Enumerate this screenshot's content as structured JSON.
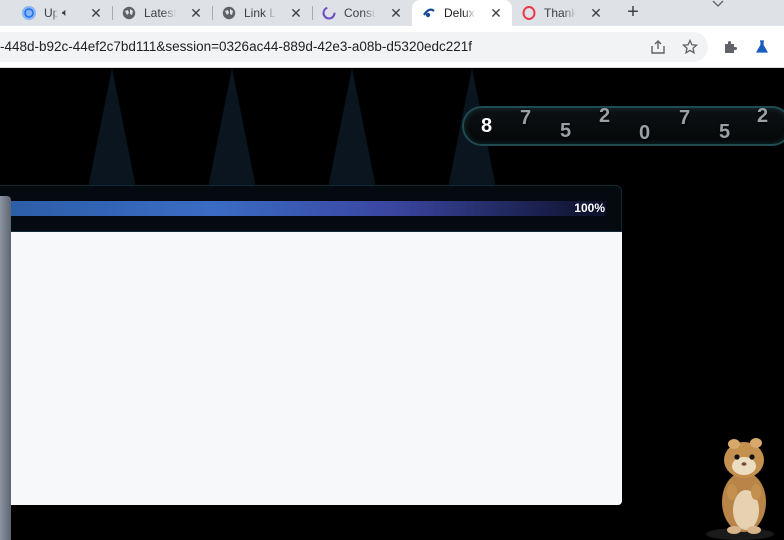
{
  "browser": {
    "tabs": [
      {
        "title": "Up",
        "favicon": "globe-blue-icon",
        "audio": true
      },
      {
        "title": "Latest",
        "favicon": "globe-icon",
        "audio": false
      },
      {
        "title": "Link L",
        "favicon": "globe-icon",
        "audio": false
      },
      {
        "title": "Consu",
        "favicon": "loading-spinner-icon",
        "audio": false
      },
      {
        "title": "Delux",
        "favicon": "deluxe-logo-icon",
        "audio": false,
        "active": true
      },
      {
        "title": "Thank",
        "favicon": "opera-logo-icon",
        "audio": false
      }
    ],
    "close_glyph": "✕",
    "new_tab_glyph": "+",
    "url": "-448d-b92c-44ef2c7bd111&session=0326ac44-889d-42e3-a08b-d5320edc221f"
  },
  "page": {
    "counter_digits": [
      "8",
      "7",
      "5",
      "2",
      "0",
      "7",
      "5",
      "2"
    ],
    "progress": {
      "label": "100%",
      "value": 1.0
    },
    "colors": {
      "background": "#000000",
      "bar_start": "#2b5da8",
      "bar_end": "#0c1028",
      "content_box": "#f7f8fa",
      "counter_border": "#1f4a4f"
    }
  }
}
